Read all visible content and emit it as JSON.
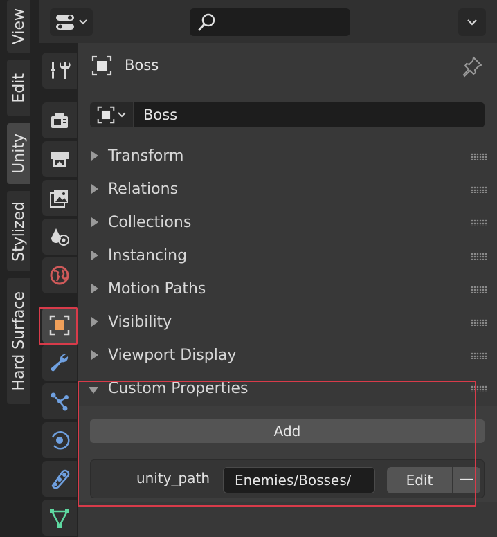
{
  "sidebar_tabs": [
    {
      "label": "View",
      "active": false
    },
    {
      "label": "Edit",
      "active": false
    },
    {
      "label": "Unity",
      "active": true
    },
    {
      "label": "Stylized",
      "active": false
    },
    {
      "label": "Hard Surface",
      "active": false
    }
  ],
  "header": {
    "search_placeholder": "",
    "editor_type_icon": "properties-editor-icon",
    "search_icon": "search-icon",
    "options_icon": "chevron-down-icon"
  },
  "property_tabs": [
    {
      "name": "tool-icon",
      "active": false
    },
    {
      "name": "render-icon",
      "active": false
    },
    {
      "name": "output-icon",
      "active": false
    },
    {
      "name": "view-layer-icon",
      "active": false
    },
    {
      "name": "scene-icon",
      "active": false
    },
    {
      "name": "world-icon",
      "active": false
    },
    {
      "name": "object-icon",
      "active": true
    },
    {
      "name": "modifier-icon",
      "active": false
    },
    {
      "name": "particles-icon",
      "active": false
    },
    {
      "name": "physics-icon",
      "active": false
    },
    {
      "name": "constraints-icon",
      "active": false
    },
    {
      "name": "data-icon",
      "active": false
    }
  ],
  "object": {
    "title": "Boss",
    "name": "Boss"
  },
  "sections": [
    {
      "label": "Transform",
      "open": false
    },
    {
      "label": "Relations",
      "open": false
    },
    {
      "label": "Collections",
      "open": false
    },
    {
      "label": "Instancing",
      "open": false
    },
    {
      "label": "Motion Paths",
      "open": false
    },
    {
      "label": "Visibility",
      "open": false
    },
    {
      "label": "Viewport Display",
      "open": false
    },
    {
      "label": "Custom Properties",
      "open": true
    }
  ],
  "custom_properties": {
    "add_label": "Add",
    "items": [
      {
        "key": "unity_path",
        "value": "Enemies/Bosses/",
        "edit_label": "Edit",
        "remove_label": "—"
      }
    ]
  },
  "colors": {
    "accent_orange": "#f0a05a",
    "highlight_red": "#d83b4a",
    "wrench_blue": "#6fa0e0",
    "world_red": "#d05a5a",
    "data_green": "#5ed8a0"
  }
}
